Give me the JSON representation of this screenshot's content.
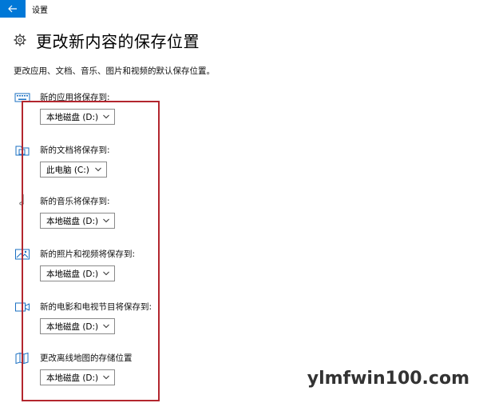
{
  "window": {
    "title": "设置",
    "back_icon": "arrow-left-icon",
    "accent": "#0078d7"
  },
  "header": {
    "icon": "gear-icon",
    "title": "更改新内容的保存位置"
  },
  "description": "更改应用、文档、音乐、图片和视频的默认保存位置。",
  "sections": [
    {
      "icon": "keyboard-icon",
      "label": "新的应用将保存到:",
      "value": "本地磁盘 (D:)"
    },
    {
      "icon": "document-folder-icon",
      "label": "新的文档将保存到:",
      "value": "此电脑 (C:)"
    },
    {
      "icon": "music-note-icon",
      "label": "新的音乐将保存到:",
      "value": "本地磁盘 (D:)"
    },
    {
      "icon": "picture-icon",
      "label": "新的照片和视频将保存到:",
      "value": "本地磁盘 (D:)"
    },
    {
      "icon": "video-icon",
      "label": "新的电影和电视节目将保存到:",
      "value": "本地磁盘 (D:)"
    },
    {
      "icon": "map-icon",
      "label": "更改离线地图的存储位置",
      "value": "本地磁盘 (D:)"
    }
  ],
  "highlight_color": "#b3262e",
  "watermark": "ylmfwin100.com"
}
